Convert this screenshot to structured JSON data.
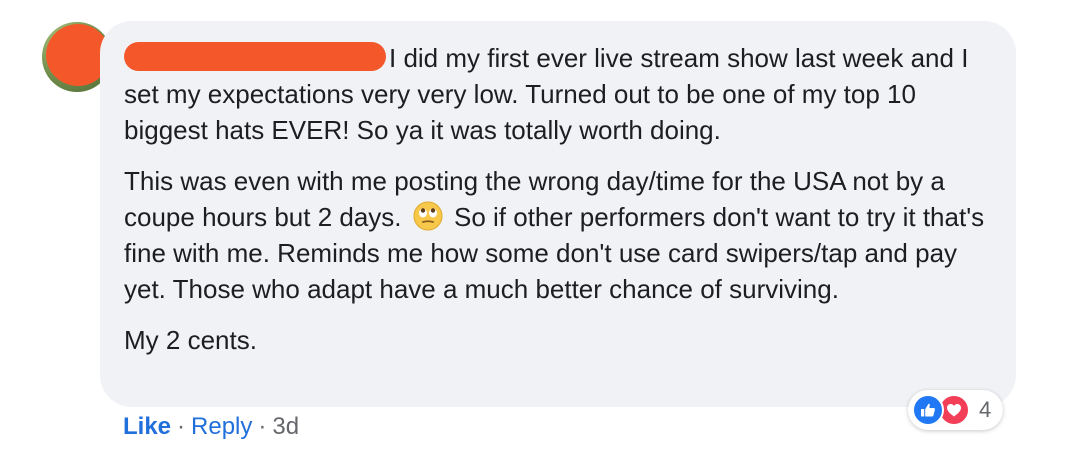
{
  "comment": {
    "paragraphs": [
      "I did my first ever live stream show last week and I set my expectations very very low. Turned out to be one of my top 10 biggest hats EVER! So ya it was totally worth doing.",
      "This was even with me posting the wrong day/time for the USA not by a coupe hours but 2 days.",
      "So if other performers don't want to try it that's fine with me. Reminds me how some don't use card swipers/tap and pay yet. Those who adapt have a much better chance of surviving.",
      "My 2 cents."
    ],
    "emoji": "face-with-rolling-eyes"
  },
  "reactions": {
    "icons": [
      "like",
      "love"
    ],
    "count": "4"
  },
  "actions": {
    "like_label": "Like",
    "separator": "·",
    "reply_label": "Reply",
    "timestamp": "3d"
  },
  "colors": {
    "bubble_bg": "#f0f2f5",
    "link_blue": "#216fdb",
    "redaction": "#f4582a",
    "like_blue": "#2078f4",
    "love_red": "#f33e58",
    "muted_text": "#65676b"
  }
}
